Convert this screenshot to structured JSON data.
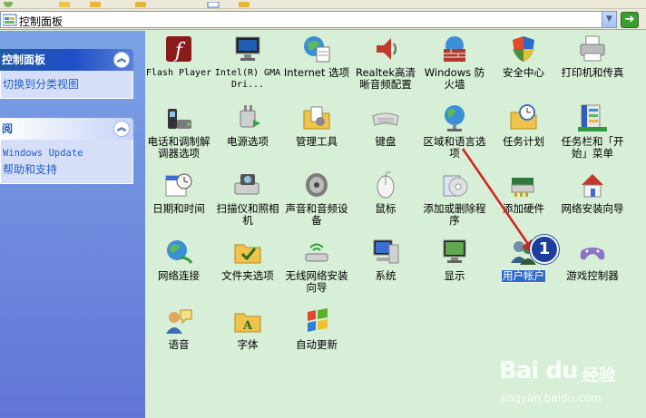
{
  "address_bar": {
    "path": "控制面板",
    "dropdown_glyph": "▼",
    "go_glyph": "➔"
  },
  "left_pane": {
    "control_panel": {
      "title": "控制面板",
      "links": [
        {
          "label": "切换到分类视图"
        }
      ]
    },
    "see_also": {
      "title": "阅",
      "links": [
        {
          "label": "Windows Update"
        },
        {
          "label": "帮助和支持"
        }
      ]
    }
  },
  "items": [
    {
      "label": "Flash Player",
      "icon": "flash-player-icon"
    },
    {
      "label": "Intel(R) GMA Dri...",
      "icon": "intel-gma-icon"
    },
    {
      "label": "Internet 选项",
      "icon": "internet-options-icon"
    },
    {
      "label": "Realtek高清晰音频配置",
      "icon": "realtek-audio-icon"
    },
    {
      "label": "Windows 防火墙",
      "icon": "firewall-icon"
    },
    {
      "label": "安全中心",
      "icon": "security-center-icon"
    },
    {
      "label": "打印机和传真",
      "icon": "printers-icon"
    },
    {
      "label": "电话和调制解调器选项",
      "icon": "phone-modem-icon"
    },
    {
      "label": "电源选项",
      "icon": "power-options-icon"
    },
    {
      "label": "管理工具",
      "icon": "admin-tools-icon"
    },
    {
      "label": "键盘",
      "icon": "keyboard-icon"
    },
    {
      "label": "区域和语言选项",
      "icon": "regional-language-icon"
    },
    {
      "label": "任务计划",
      "icon": "scheduled-tasks-icon"
    },
    {
      "label": "任务栏和「开始」菜单",
      "icon": "taskbar-start-icon"
    },
    {
      "label": "日期和时间",
      "icon": "date-time-icon"
    },
    {
      "label": "扫描仪和照相机",
      "icon": "scanner-camera-icon"
    },
    {
      "label": "声音和音频设备",
      "icon": "sound-devices-icon"
    },
    {
      "label": "鼠标",
      "icon": "mouse-icon"
    },
    {
      "label": "添加或删除程序",
      "icon": "add-remove-programs-icon"
    },
    {
      "label": "添加硬件",
      "icon": "add-hardware-icon"
    },
    {
      "label": "网络安装向导",
      "icon": "network-setup-icon"
    },
    {
      "label": "网络连接",
      "icon": "network-connections-icon"
    },
    {
      "label": "文件夹选项",
      "icon": "folder-options-icon"
    },
    {
      "label": "无线网络安装向导",
      "icon": "wireless-setup-icon"
    },
    {
      "label": "系统",
      "icon": "system-icon"
    },
    {
      "label": "显示",
      "icon": "display-icon"
    },
    {
      "label": "用户帐户",
      "icon": "user-accounts-icon",
      "selected": true
    },
    {
      "label": "游戏控制器",
      "icon": "game-controllers-icon"
    },
    {
      "label": "语音",
      "icon": "speech-icon"
    },
    {
      "label": "字体",
      "icon": "fonts-icon"
    },
    {
      "label": "自动更新",
      "icon": "automatic-updates-icon"
    }
  ],
  "annotation": {
    "step": "1",
    "arrow_color": "#d42020"
  },
  "watermark": {
    "logo": "Bai du",
    "sub": "经验",
    "url": "jingyan.baidu.com"
  },
  "colors": {
    "content_bg": "#d6efd6",
    "selected_bg": "#316ac5",
    "link": "#215dc6"
  }
}
